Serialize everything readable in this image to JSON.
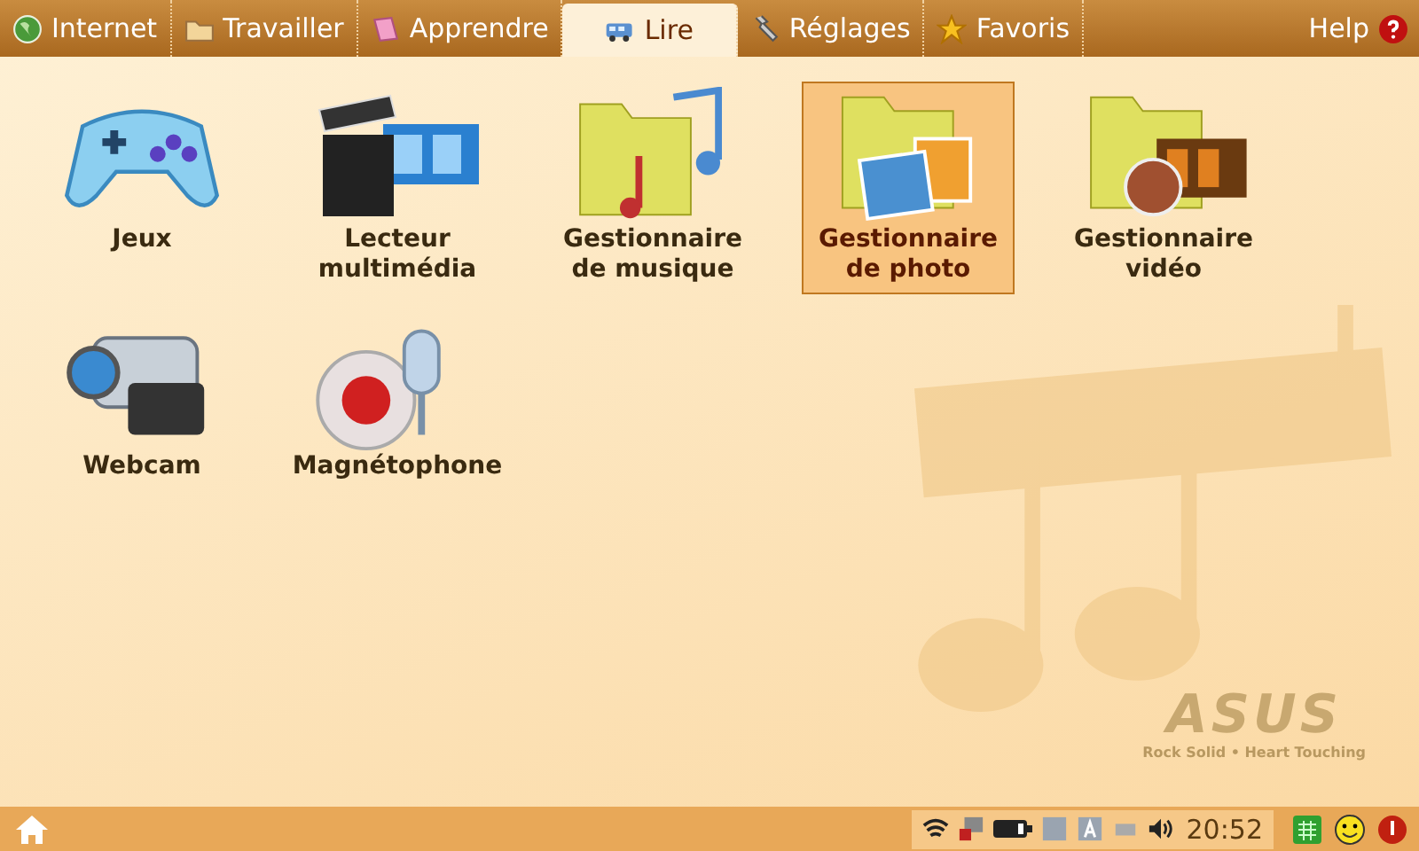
{
  "tabs": [
    {
      "label": "Internet",
      "kind": "globe",
      "selected": false
    },
    {
      "label": "Travailler",
      "kind": "folder",
      "selected": false
    },
    {
      "label": "Apprendre",
      "kind": "book",
      "selected": false
    },
    {
      "label": "Lire",
      "kind": "bus",
      "selected": true
    },
    {
      "label": "Réglages",
      "kind": "wrench",
      "selected": false
    },
    {
      "label": "Favoris",
      "kind": "star",
      "selected": false
    }
  ],
  "help": {
    "label": "Help"
  },
  "apps": [
    {
      "label": "Jeux",
      "kind": "gamepad",
      "selected": false
    },
    {
      "label": "Lecteur\nmultimédia",
      "kind": "clapper",
      "selected": false
    },
    {
      "label": "Gestionnaire\nde musique",
      "kind": "music",
      "selected": false
    },
    {
      "label": "Gestionnaire\nde photo",
      "kind": "photo",
      "selected": true
    },
    {
      "label": "Gestionnaire\nvidéo",
      "kind": "video",
      "selected": false
    },
    {
      "label": "Webcam",
      "kind": "webcam",
      "selected": false
    },
    {
      "label": "Magnétophone",
      "kind": "mic",
      "selected": false
    }
  ],
  "brand": {
    "logo": "ASUS",
    "tagline": "Rock Solid • Heart Touching"
  },
  "taskbar": {
    "time": "20:52"
  }
}
